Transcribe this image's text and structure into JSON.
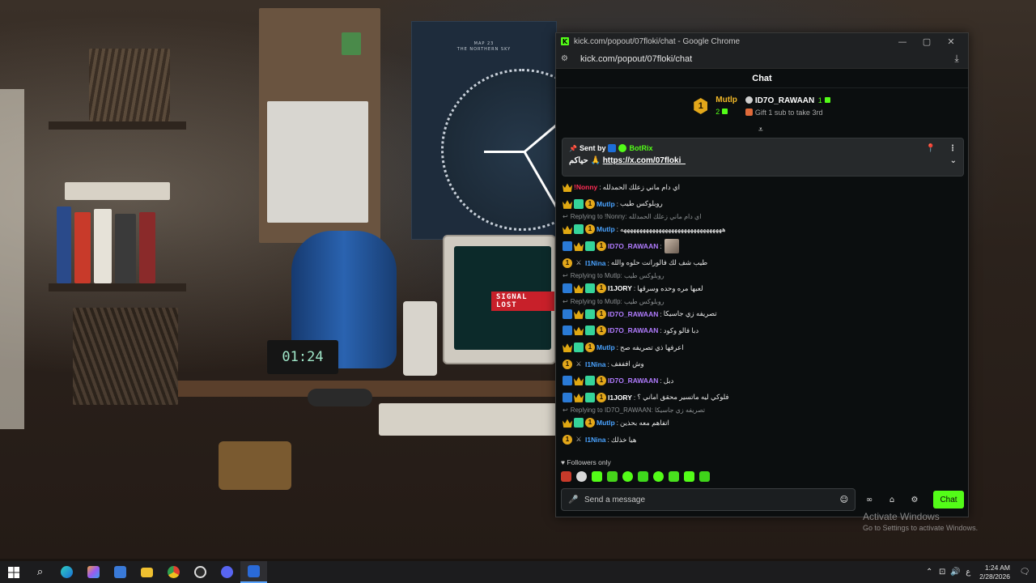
{
  "colors": {
    "brand_green": "#53fc18",
    "gold": "#f1b828",
    "blue_name": "#4aa3ff",
    "purple_name": "#b17cff",
    "red_name": "#ff2d55",
    "chat_bg": "#0b0e0f"
  },
  "wallpaper": {
    "poster_title": "MAP 23\nTHE NORTHERN SKY",
    "signal_text": "SIGNAL LOST",
    "clock_display": "01:24"
  },
  "window": {
    "title": "kick.com/popout/07floki/chat - Google Chrome",
    "url": "kick.com/popout/07floki/chat",
    "min_icon": "—",
    "max_icon": "▢",
    "close_icon": "✕"
  },
  "chat": {
    "header": "Chat",
    "leaderboard": {
      "first": {
        "rank": "1",
        "name": "Mutlp",
        "count": "2"
      },
      "second": {
        "name": "ID7O_RAWAAN",
        "count": "1",
        "note": "Gift 1 sub to take 3rd"
      }
    },
    "pinned": {
      "sent_by_label": "Sent by",
      "sender": "BotRix",
      "content_prefix": "حياكم 🙏",
      "link": "https://x.com/07floki_"
    },
    "messages": [
      {
        "kind": "msg",
        "badges": [
          "crown"
        ],
        "user": "!Nonny",
        "color": "#ff2d55",
        "text": "اي دام ماني زعلك الحمدلله"
      },
      {
        "kind": "msg",
        "badges": [
          "crown",
          "gift",
          "one"
        ],
        "user": "Mutlp",
        "color": "#4aa3ff",
        "text": "روبلوكس طيب"
      },
      {
        "kind": "reply",
        "text": "Replying to !Nonny: اي دام ماني زعلك الحمدلله"
      },
      {
        "kind": "msg",
        "badges": [
          "crown",
          "gift",
          "one"
        ],
        "user": "Mutlp",
        "color": "#4aa3ff",
        "text": "ههههههههههههههههههههههههههههههههه"
      },
      {
        "kind": "msg",
        "badges": [
          "bot",
          "crown",
          "gift",
          "one"
        ],
        "user": "ID7O_RAWAAN",
        "color": "#b17cff",
        "text": "",
        "emote": true
      },
      {
        "kind": "msg",
        "badges": [
          "one",
          "sword"
        ],
        "user": "I1Nina",
        "color": "#4aa3ff",
        "text": "طيب شف لك فالورانت حلوه والله"
      },
      {
        "kind": "reply",
        "text": "Replying to Mutlp: روبلوكس طيب"
      },
      {
        "kind": "msg",
        "badges": [
          "bot",
          "crown",
          "gift",
          "one"
        ],
        "user": "I1JORY",
        "color": "#ffffff",
        "text": "لعبها مره وحده وسرقها"
      },
      {
        "kind": "reply",
        "text": "Replying to Mutlp: روبلوكس طيب"
      },
      {
        "kind": "msg",
        "badges": [
          "bot",
          "crown",
          "gift",
          "one"
        ],
        "user": "ID7O_RAWAAN",
        "color": "#b17cff",
        "text": "تصريفه زي جاسيكا"
      },
      {
        "kind": "msg",
        "badges": [
          "bot",
          "crown",
          "gift",
          "one"
        ],
        "user": "ID7O_RAWAAN",
        "color": "#b17cff",
        "text": "دبا فالو وكود"
      },
      {
        "kind": "msg",
        "badges": [
          "crown",
          "gift",
          "one"
        ],
        "user": "Mutlp",
        "color": "#4aa3ff",
        "text": "اعرفها ذي تصريفه صح"
      },
      {
        "kind": "msg",
        "badges": [
          "one",
          "sword"
        ],
        "user": "I1Nina",
        "color": "#4aa3ff",
        "text": "وش افففف"
      },
      {
        "kind": "msg",
        "badges": [
          "bot",
          "crown",
          "gift",
          "one"
        ],
        "user": "ID7O_RAWAAN",
        "color": "#b17cff",
        "text": "دبل"
      },
      {
        "kind": "msg",
        "badges": [
          "bot",
          "crown",
          "gift",
          "one"
        ],
        "user": "I1JORY",
        "color": "#ffffff",
        "text": "فلوكي ليه ماتسير محقق اماني ؟"
      },
      {
        "kind": "reply",
        "text": "Replying to ID7O_RAWAAN: تصريفه زي جاسيكا"
      },
      {
        "kind": "msg",
        "badges": [
          "crown",
          "gift",
          "one"
        ],
        "user": "Mutlp",
        "color": "#4aa3ff",
        "text": "اتفاهم معه بحذين"
      },
      {
        "kind": "msg",
        "badges": [
          "one",
          "sword"
        ],
        "user": "I1Nina",
        "color": "#4aa3ff",
        "text": "هيا خذلك"
      }
    ],
    "followers_only": "Followers only",
    "input_placeholder": "Send a message",
    "send_button": "Chat"
  },
  "activate_windows": {
    "title": "Activate Windows",
    "subtitle": "Go to Settings to activate Windows."
  },
  "taskbar": {
    "time": "1:24 AM",
    "date": "2/28/2026",
    "lang": "ع"
  }
}
